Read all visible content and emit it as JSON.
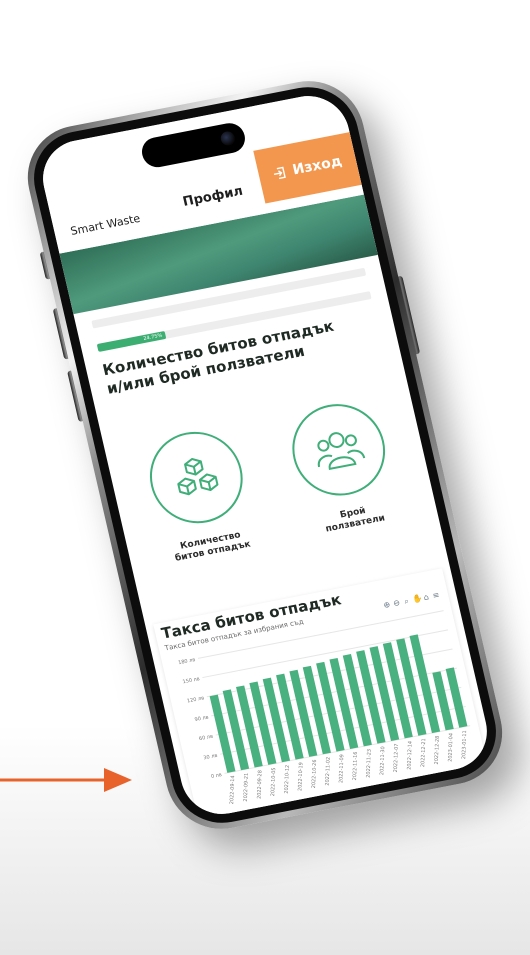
{
  "app": {
    "brand": "Smart Waste",
    "nav_title": "Профил",
    "logout_label": "Изход"
  },
  "progress": {
    "label": "24.75%",
    "value": 0.2475
  },
  "section": {
    "title_line1": "Количество битов отпадък",
    "title_line2": "и/или брой ползватели"
  },
  "options": [
    {
      "label_line1": "Количество",
      "label_line2": "битов отпадък",
      "icon": "boxes-icon"
    },
    {
      "label_line1": "Брой",
      "label_line2": "ползватели",
      "icon": "users-icon"
    }
  ],
  "chart": {
    "title": "Такса битов отпадък",
    "subtitle": "Такса битов отпадък за избрания съд",
    "toolbar_icons": [
      "zoom-in-icon",
      "zoom-out-icon",
      "magnify-icon",
      "pan-icon",
      "home-icon",
      "menu-icon"
    ]
  },
  "colors": {
    "accent": "#f2974d",
    "green": "#3dae72",
    "bar": "#49b07f"
  },
  "chart_data": {
    "type": "bar",
    "title": "Такса битов отпадък",
    "ylim": [
      0,
      180
    ],
    "y_ticks": [
      "0 лв",
      "30 лв",
      "60 лв",
      "90 лв",
      "120 лв",
      "150 лв",
      "180 лв"
    ],
    "categories": [
      "2022-09-14",
      "2022-09-21",
      "2022-09-28",
      "2022-10-05",
      "2022-10-12",
      "2022-10-19",
      "2022-10-26",
      "2022-11-02",
      "2022-11-09",
      "2022-11-16",
      "2022-11-23",
      "2022-11-30",
      "2022-12-07",
      "2022-12-14",
      "2022-12-21",
      "2022-12-28",
      "2023-01-04",
      "2023-01-11"
    ],
    "values": [
      120,
      124,
      126,
      128,
      130,
      132,
      134,
      136,
      138,
      140,
      142,
      144,
      146,
      148,
      150,
      152,
      90,
      92
    ],
    "grid": true
  }
}
